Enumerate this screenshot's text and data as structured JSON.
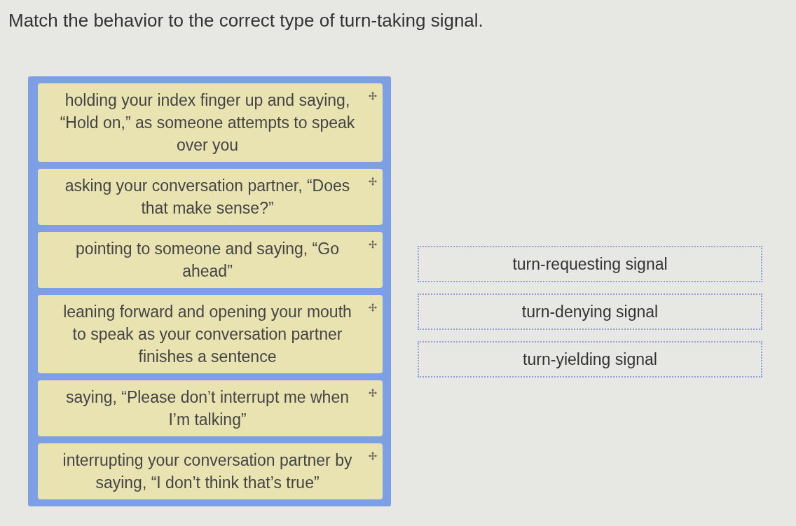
{
  "question": {
    "prompt": "Match the behavior to the correct type of turn-taking signal."
  },
  "behaviors": [
    {
      "text": "holding your index finger up and saying, “Hold on,” as someone attempts to speak over you"
    },
    {
      "text": "asking your conversation partner, “Does that make sense?”"
    },
    {
      "text": "pointing to someone and saying, “Go ahead”"
    },
    {
      "text": "leaning forward and opening your mouth to speak as your conversation partner finishes a sentence"
    },
    {
      "text": "saying, “Please don’t interrupt me when I’m talking”"
    },
    {
      "text": "interrupting your conversation partner by saying, “I don’t think that’s true”"
    }
  ],
  "targets": [
    {
      "label": "turn-requesting signal"
    },
    {
      "label": "turn-denying signal"
    },
    {
      "label": "turn-yielding signal"
    }
  ]
}
